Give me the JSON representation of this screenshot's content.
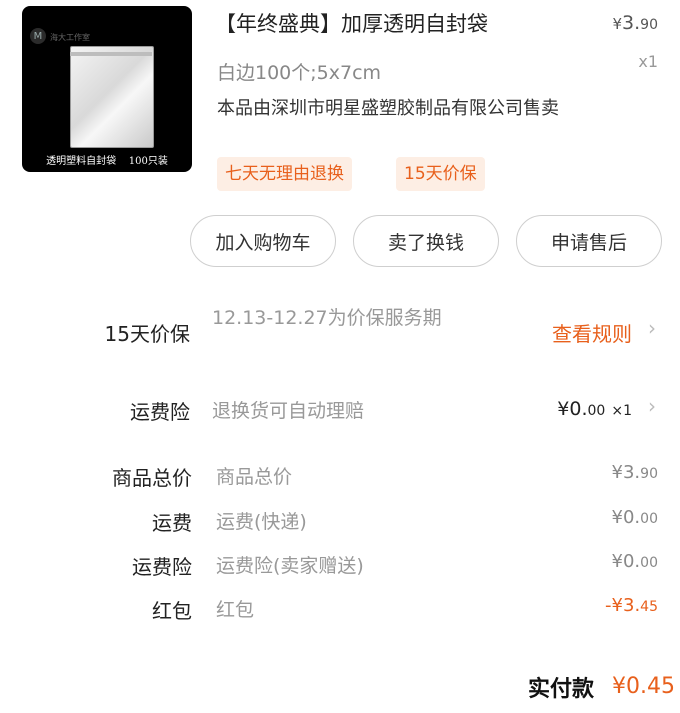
{
  "product": {
    "image_caption": "透明塑料自封袋    100只装",
    "image_brand": "海大工作室",
    "title": "【年终盛典】加厚透明自封袋",
    "price_yen": "¥",
    "price_int": "3.",
    "price_dec": "90",
    "quantity": "x1",
    "spec": "白边100个;5x7cm",
    "seller": "本品由深圳市明星盛塑胶制品有限公司售卖",
    "tags": [
      "七天无理由退换",
      "15天价保"
    ]
  },
  "actions": {
    "add_cart": "加入购物车",
    "resell": "卖了换钱",
    "after_sale": "申请售后"
  },
  "services": {
    "price_guarantee": {
      "label": "15天价保",
      "desc": "12.13-12.27为价保服务期",
      "link": "查看规则"
    },
    "shipping_insurance": {
      "label": "运费险",
      "desc": "退换货可自动理赔",
      "price_int": "¥0.",
      "price_dec": "00",
      "qty": "×1"
    }
  },
  "summary": [
    {
      "label": "商品总价",
      "desc": "商品总价",
      "int": "¥3.",
      "dec": "90",
      "red": false
    },
    {
      "label": "运费",
      "desc": "运费(快递)",
      "int": "¥0.",
      "dec": "00",
      "red": false
    },
    {
      "label": "运费险",
      "desc": "运费险(卖家赠送)",
      "int": "¥0.",
      "dec": "00",
      "red": false
    },
    {
      "label": "红包",
      "desc": "红包",
      "int": "-¥3.",
      "dec": "45",
      "red": true
    }
  ],
  "total": {
    "label": "实付款",
    "value": "¥0.45"
  },
  "colors": {
    "accent": "#e8601c",
    "tag_bg": "#fdeee4",
    "muted": "#999999"
  },
  "icons": {
    "chevron": "chevron-right-icon"
  }
}
